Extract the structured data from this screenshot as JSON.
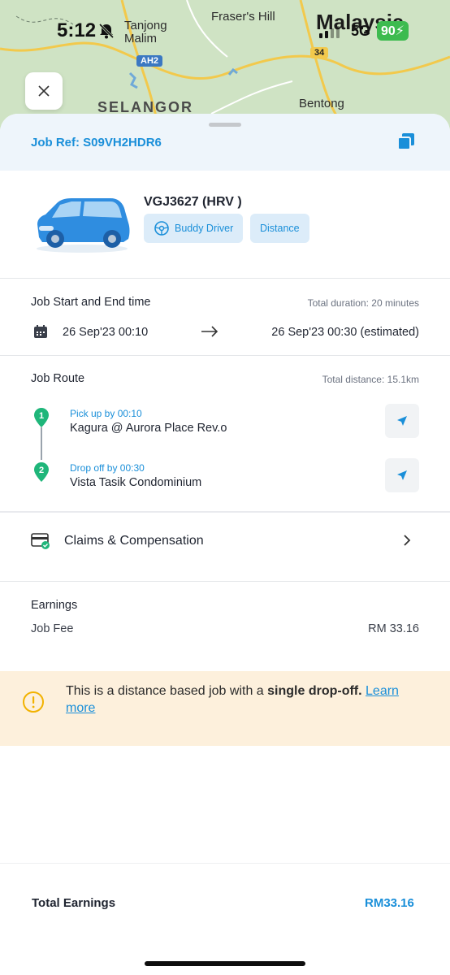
{
  "status_bar": {
    "time": "5:12",
    "network": "5G",
    "battery": "90"
  },
  "map": {
    "labels": {
      "tanjong_malim": "Tanjong\nMalim",
      "frasers_hill": "Fraser's Hill",
      "malaysia": "Malaysia",
      "selangor": "SELANGOR",
      "bentong": "Bentong",
      "ah2": "AH2",
      "route34": "34"
    }
  },
  "job": {
    "ref": "Job Ref: S09VH2HDR6"
  },
  "vehicle": {
    "plate": "VGJ3627 (HRV )",
    "chips": [
      "Buddy Driver",
      "Distance"
    ]
  },
  "time_section": {
    "title": "Job Start and End time",
    "duration": "Total duration:  20 minutes",
    "start": "26 Sep'23 00:10",
    "end": "26 Sep'23 00:30 (estimated)"
  },
  "route": {
    "title": "Job Route",
    "distance": "Total distance: 15.1km",
    "stops": [
      {
        "number": "1",
        "label": "Pick up by 00:10",
        "name": "Kagura @ Aurora Place Rev.o"
      },
      {
        "number": "2",
        "label": "Drop off by 00:30",
        "name": "Vista Tasik Condominium"
      }
    ]
  },
  "claims": {
    "label": "Claims & Compensation"
  },
  "earnings": {
    "title": "Earnings",
    "fee_label": "Job Fee",
    "fee_value": "RM 33.16"
  },
  "notice": {
    "text_prefix": "This is a distance based job with a ",
    "text_bold": "single drop-off.",
    "link": "Learn more"
  },
  "footer": {
    "total_label": "Total Earnings",
    "total_value": "RM33.16"
  },
  "colors": {
    "accent": "#1a8fd9",
    "pin": "#1fb67a",
    "notice_bg": "#fdf0dc",
    "warning": "#f2b200"
  }
}
